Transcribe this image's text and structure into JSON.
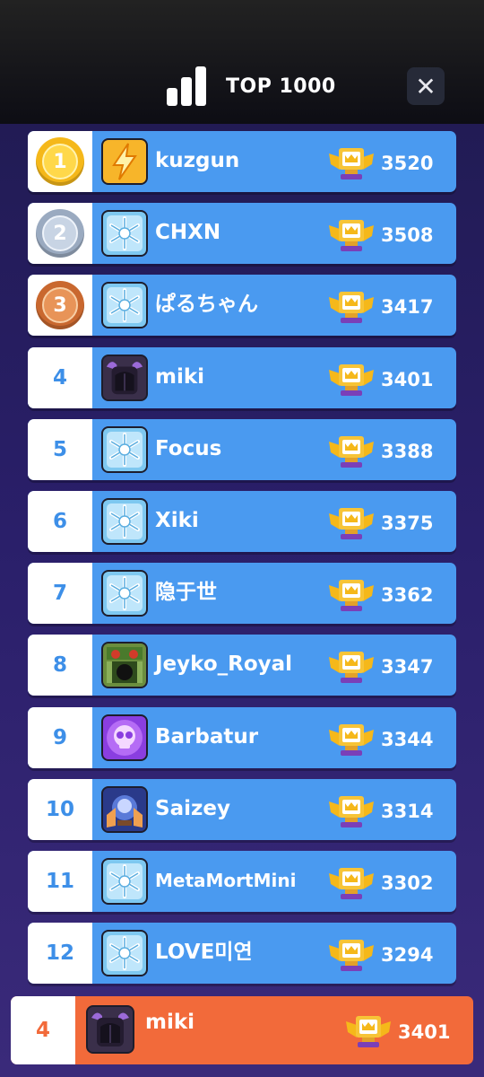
{
  "header": {
    "title": "TOP 1000",
    "close_label": "✕"
  },
  "leaderboard": [
    {
      "rank": "1",
      "name": "kuzgun",
      "score": "3520",
      "medal": "gold-medal",
      "avatar": "lightning-icon"
    },
    {
      "rank": "2",
      "name": "CHXN",
      "score": "3508",
      "medal": "silver-medal",
      "avatar": "snowflake-icon"
    },
    {
      "rank": "3",
      "name": "ぱるちゃん",
      "score": "3417",
      "medal": "bronze-medal",
      "avatar": "snowflake-icon"
    },
    {
      "rank": "4",
      "name": "miki",
      "score": "3401",
      "avatar": "dark-creature-icon"
    },
    {
      "rank": "5",
      "name": "Focus",
      "score": "3388",
      "avatar": "snowflake-icon"
    },
    {
      "rank": "6",
      "name": "Xiki",
      "score": "3375",
      "avatar": "snowflake-icon"
    },
    {
      "rank": "7",
      "name": "隐于世",
      "score": "3362",
      "avatar": "snowflake-icon"
    },
    {
      "rank": "8",
      "name": "Jeyko_Royal",
      "score": "3347",
      "avatar": "green-robot-icon"
    },
    {
      "rank": "9",
      "name": "Barbatur",
      "score": "3344",
      "avatar": "purple-skull-icon"
    },
    {
      "rank": "10",
      "name": "Saizey",
      "score": "3314",
      "avatar": "orb-icon"
    },
    {
      "rank": "11",
      "name": "MetaMortMini",
      "score": "3302",
      "avatar": "snowflake-icon"
    },
    {
      "rank": "12",
      "name": "LOVE미연",
      "score": "3294",
      "avatar": "snowflake-icon"
    }
  ],
  "self": {
    "rank": "4",
    "name": "miki",
    "score": "3401",
    "avatar": "dark-creature-icon"
  },
  "colors": {
    "row": "#4a9af0",
    "self": "#f26a3a",
    "rank_text": "#3d8fe8"
  }
}
